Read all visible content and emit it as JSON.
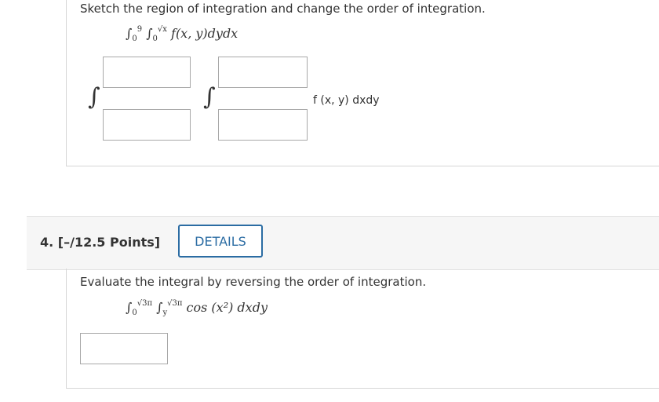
{
  "q3": {
    "prompt": "Sketch the region of integration and change the order of integration.",
    "integral": {
      "lower1": "0",
      "upper1": "9",
      "lower2": "0",
      "upper2": "√x",
      "body": "f(x, y)dydx"
    },
    "integrand_text": "f (x, y) dxdy"
  },
  "q4": {
    "points": "4.  [–/12.5 Points]",
    "details_label": "DETAILS",
    "prompt": "Evaluate the integral by reversing the order of integration.",
    "integral": {
      "lower1": "0",
      "upper1": "√3π",
      "lower2": "y",
      "upper2": "√3π",
      "body": "cos (x²) dxdy"
    }
  },
  "colors": {
    "accent": "#2b6ca3",
    "text": "#333333",
    "border": "#a8a8a8",
    "header_bg": "#f6f6f6"
  }
}
